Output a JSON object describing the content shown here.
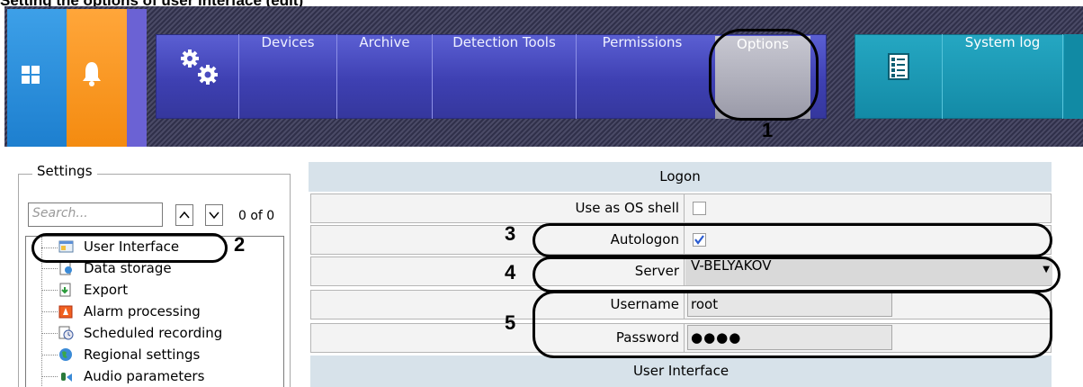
{
  "caption": "Setting the options of user interface (edit)",
  "toolbar": {
    "nav_items": [
      "Devices",
      "Archive",
      "Detection Tools",
      "Permissions",
      "Options"
    ],
    "system_log": "System log"
  },
  "settings": {
    "legend": "Settings",
    "search_placeholder": "Search...",
    "up_label": "^",
    "down_label": "v",
    "counter": "0 of 0",
    "tree": [
      "User Interface",
      "Data storage",
      "Export",
      "Alarm processing",
      "Scheduled recording",
      "Regional settings",
      "Audio parameters"
    ]
  },
  "logon": {
    "header": "Logon",
    "use_as_os_shell": {
      "label": "Use as OS shell",
      "checked": false
    },
    "autologon": {
      "label": "Autologon",
      "checked": true
    },
    "server": {
      "label": "Server",
      "value": "V-BELYAKOV"
    },
    "username": {
      "label": "Username",
      "value": "root"
    },
    "password": {
      "label": "Password",
      "value": "●●●●"
    }
  },
  "user_interface_header": "User Interface",
  "callouts": [
    "1",
    "2",
    "3",
    "4",
    "5"
  ],
  "colors": {
    "nav_blue": "#3e40b2",
    "teal": "#138aa6",
    "tile_blue": "#1d7fcf",
    "tile_orange": "#f48b10"
  }
}
